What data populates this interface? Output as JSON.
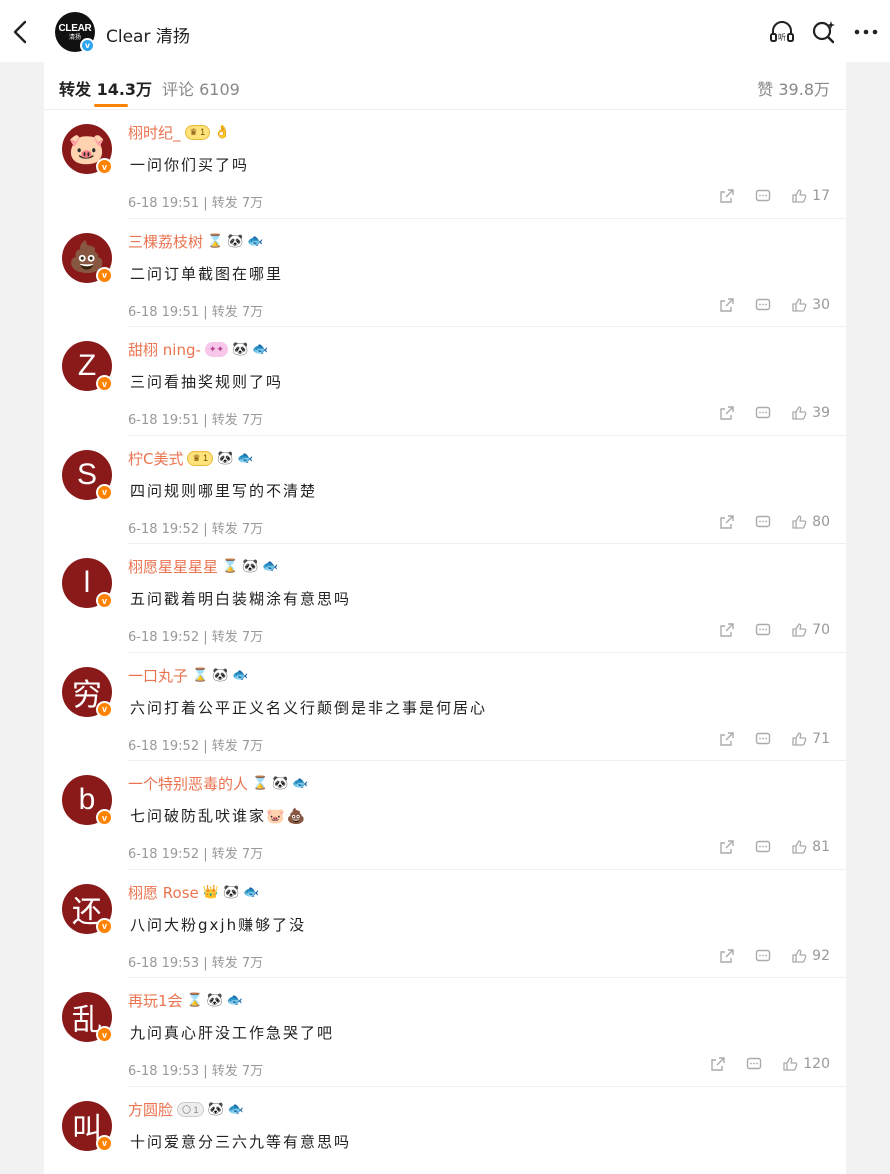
{
  "header": {
    "account_name": "Clear 清扬",
    "logo_text": "CLEAR",
    "logo_sub": "清扬"
  },
  "tabs": {
    "repost": "转发 14.3万",
    "comment": "评论 6109",
    "likes": "赞 39.8万"
  },
  "comments": [
    {
      "user": "栩时纪_",
      "avatar": "🐷",
      "text": "一问你们买了吗",
      "meta": "6-18 19:51 | 转发 7万",
      "likes": "17"
    },
    {
      "user": "三棵荔枝树",
      "avatar": "💩",
      "text": "二问订单截图在哪里",
      "meta": "6-18 19:51 | 转发 7万",
      "likes": "30"
    },
    {
      "user": "甜栩 ning-",
      "avatar": "Z",
      "text": "三问看抽奖规则了吗",
      "meta": "6-18 19:51 | 转发 7万",
      "likes": "39"
    },
    {
      "user": "柠C美式",
      "avatar": "S",
      "text": "四问规则哪里写的不清楚",
      "meta": "6-18 19:52 | 转发 7万",
      "likes": "80"
    },
    {
      "user": "栩愿星星星星",
      "avatar": "l",
      "text": "五问戳着明白装糊涂有意思吗",
      "meta": "6-18 19:52 | 转发 7万",
      "likes": "70"
    },
    {
      "user": "一口丸子",
      "avatar": "穷",
      "text": "六问打着公平正义名义行颠倒是非之事是何居心",
      "meta": "6-18 19:52 | 转发 7万",
      "likes": "71"
    },
    {
      "user": "一个特别恶毒的人",
      "avatar": "b",
      "text": "七问破防乱吠谁家🐷💩",
      "meta": "6-18 19:52 | 转发 7万",
      "likes": "81"
    },
    {
      "user": "栩愿 Rose",
      "avatar": "还",
      "text": "八问大粉gxjh赚够了没",
      "meta": "6-18 19:53 | 转发 7万",
      "likes": "92"
    },
    {
      "user": "再玩1会",
      "avatar": "乱",
      "text": "九问真心肝没工作急哭了吧",
      "meta": "6-18 19:53 | 转发 7万",
      "likes": "120"
    },
    {
      "user": "方圆脸",
      "avatar": "叫",
      "text": "十问爱意分三六九等有意思吗",
      "meta": "",
      "likes": ""
    }
  ],
  "colors": {
    "accent": "#ff8200",
    "username": "#eb7350",
    "avatar_bg": "#8a1a1a"
  }
}
